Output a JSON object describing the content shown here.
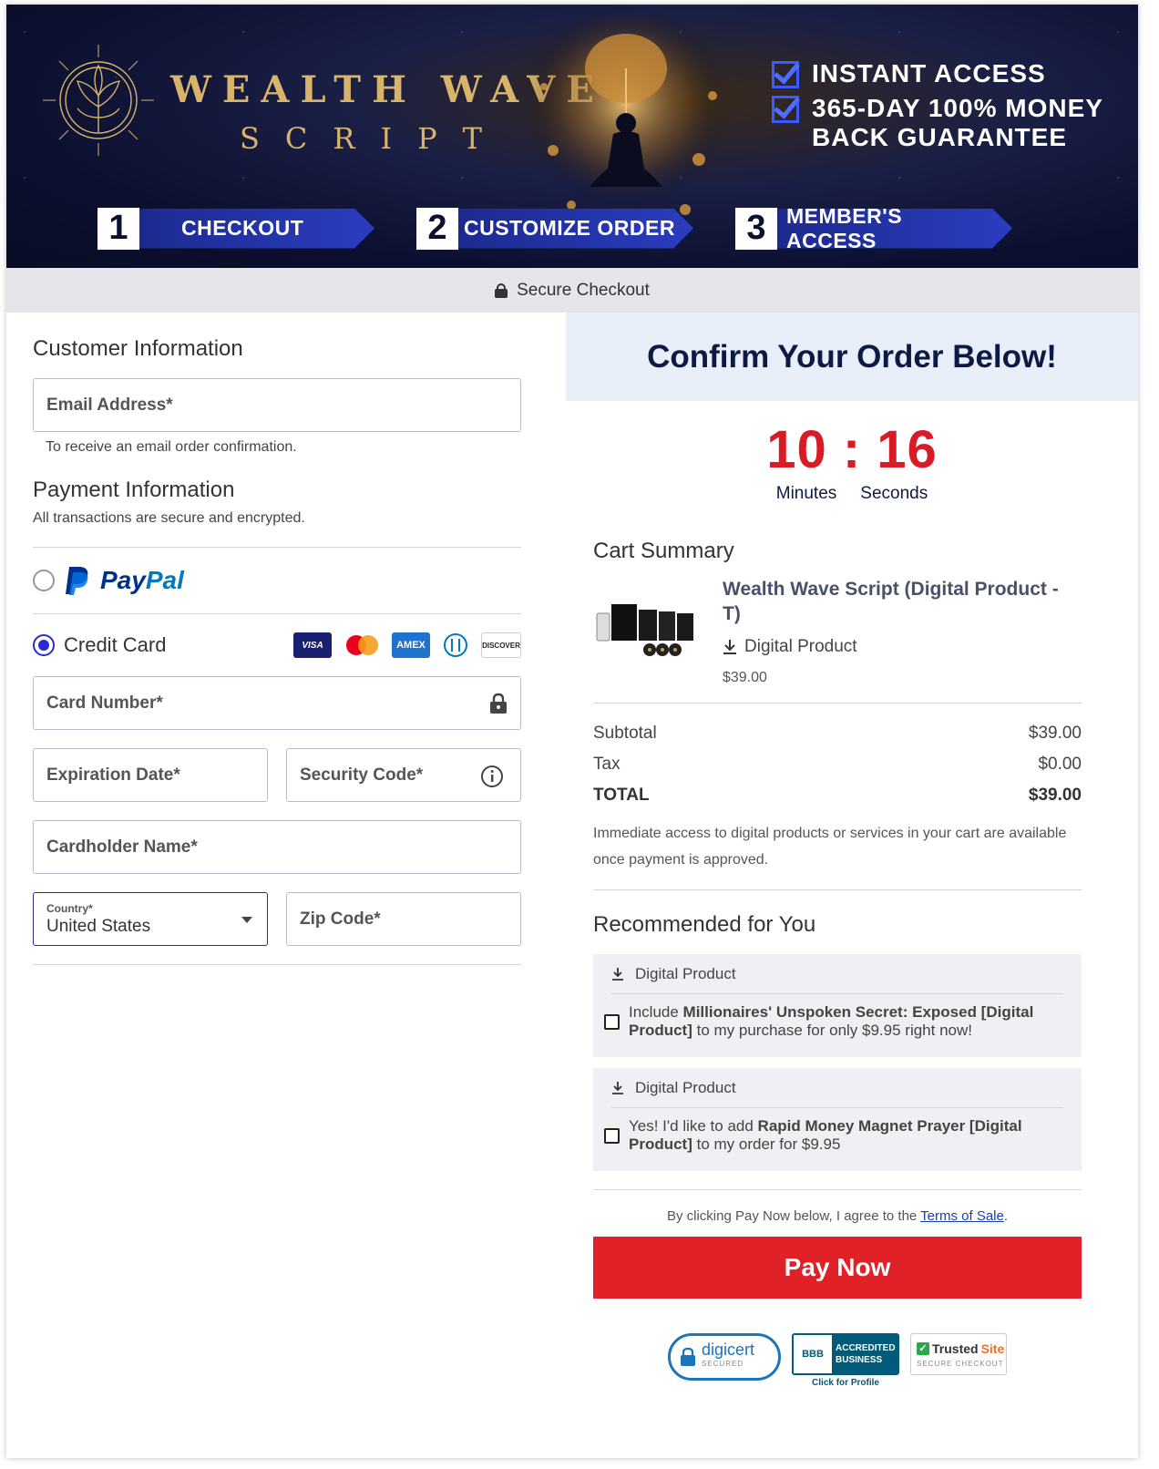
{
  "header": {
    "brand_line1": "WEALTH WAVE",
    "brand_line2": "SCRIPT",
    "guarantee": [
      "INSTANT ACCESS",
      "365-DAY 100% MONEY BACK GUARANTEE"
    ],
    "steps": [
      {
        "num": "1",
        "label": "CHECKOUT"
      },
      {
        "num": "2",
        "label": "CUSTOMIZE ORDER"
      },
      {
        "num": "3",
        "label": "MEMBER'S ACCESS"
      }
    ],
    "secure_label": "Secure Checkout"
  },
  "customer": {
    "title": "Customer Information",
    "email_placeholder": "Email Address*",
    "email_hint": "To receive an email order confirmation."
  },
  "payment": {
    "title": "Payment Information",
    "subtitle": "All transactions are secure and encrypted.",
    "paypal_label_a": "Pay",
    "paypal_label_b": "Pal",
    "credit_card_label": "Credit Card",
    "card_brands": [
      "VISA",
      "AMEX",
      "DISCOVER"
    ],
    "card_number": "Card Number*",
    "expiration": "Expiration Date*",
    "security_code": "Security Code*",
    "cardholder": "Cardholder Name*",
    "country_label": "Country*",
    "country_value": "United States",
    "zip": "Zip Code*"
  },
  "order": {
    "confirm_title": "Confirm Your Order Below!",
    "timer": {
      "minutes": "10",
      "separator": ":",
      "seconds": "16",
      "minutes_label": "Minutes",
      "seconds_label": "Seconds"
    },
    "cart_title": "Cart Summary",
    "product_name": "Wealth Wave Script (Digital Product - T)",
    "product_type": "Digital Product",
    "product_price": "$39.00",
    "subtotal_label": "Subtotal",
    "subtotal_value": "$39.00",
    "tax_label": "Tax",
    "tax_value": "$0.00",
    "total_label": "TOTAL",
    "total_value": "$39.00",
    "access_note": "Immediate access to digital products or services in your cart are available once payment is approved."
  },
  "recommended": {
    "title": "Recommended for You",
    "items": [
      {
        "type": "Digital Product",
        "pre": "Include ",
        "bold": "Millionaires' Unspoken Secret: Exposed [Digital Product]",
        "post": " to my purchase for only $9.95 right now!"
      },
      {
        "type": "Digital Product",
        "pre": "Yes! I'd like to add ",
        "bold": "Rapid Money Magnet Prayer [Digital Product]",
        "post": " to my order for $9.95"
      }
    ]
  },
  "terms": {
    "pre": "By clicking Pay Now below, I agree to the ",
    "link": "Terms of Sale",
    "post": "."
  },
  "pay_button": "Pay Now",
  "badges": {
    "digicert": "digicert",
    "digicert_sub": "SECURED",
    "bbb_line1": "ACCREDITED",
    "bbb_line2": "BUSINESS",
    "bbb_mark": "BBB",
    "bbb_link": "Click for Profile",
    "trusted_a": "Trusted",
    "trusted_b": "Site",
    "trusted_sub": "SECURE CHECKOUT"
  },
  "colors": {
    "accent": "#2b2bd4",
    "pay": "#e02128",
    "timer": "#d91b25",
    "navy": "#0d1a44"
  }
}
